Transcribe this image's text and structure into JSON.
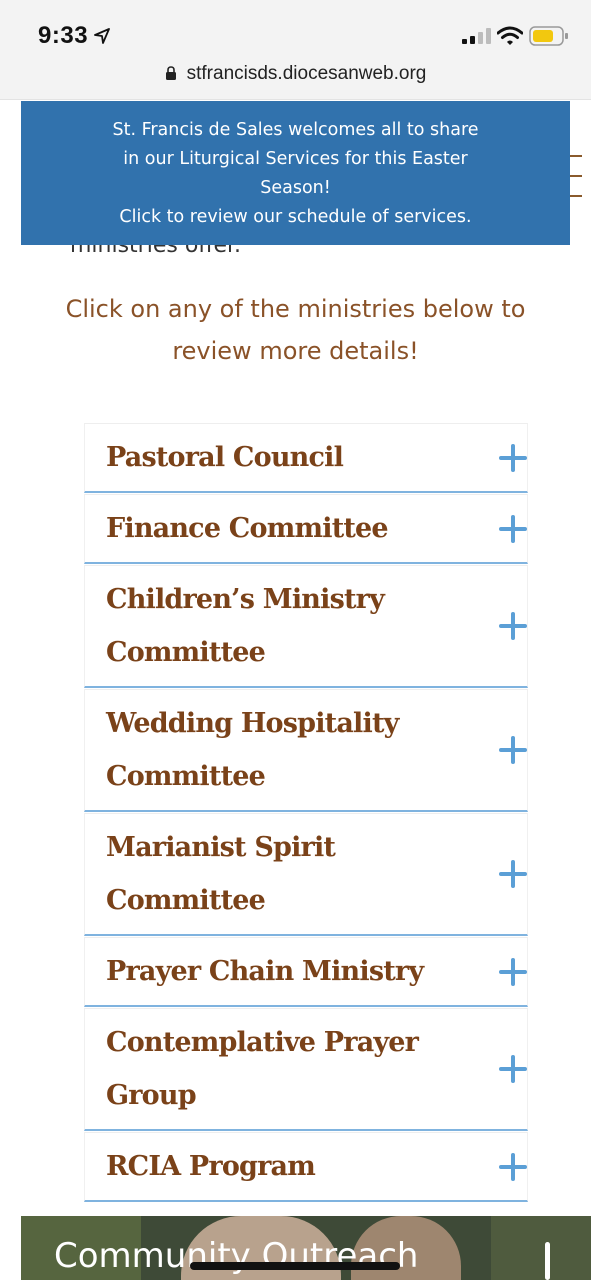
{
  "status_bar": {
    "time": "9:33",
    "url": "stfrancisds.diocesanweb.org"
  },
  "banner": {
    "line1": "St. Francis de Sales welcomes all to share",
    "line2": "in our Liturgical Services for this Easter",
    "line3": "Season!",
    "line4": "Click to review our schedule of services."
  },
  "page": {
    "cut_text": "ministries offer.",
    "intro": "Click on any of the ministries below to review more details!"
  },
  "accordion": {
    "items": [
      {
        "label": "Pastoral Council"
      },
      {
        "label": "Finance Committee"
      },
      {
        "label": "Children’s Ministry Committee"
      },
      {
        "label": "Wedding Hospitality Committee"
      },
      {
        "label": "Marianist Spirit Committee"
      },
      {
        "label": "Prayer Chain Ministry"
      },
      {
        "label": "Contemplative Prayer Group"
      },
      {
        "label": "RCIA Program"
      }
    ]
  },
  "outreach": {
    "title": "Community Outreach"
  },
  "colors": {
    "banner_bg": "#3172ad",
    "heading_brown": "#7a4219",
    "accent_blue": "#5b9fd6"
  },
  "icons": [
    "location-arrow-icon",
    "signal-icon",
    "wifi-icon",
    "battery-icon",
    "lock-icon",
    "menu-icon",
    "plus-icon"
  ]
}
